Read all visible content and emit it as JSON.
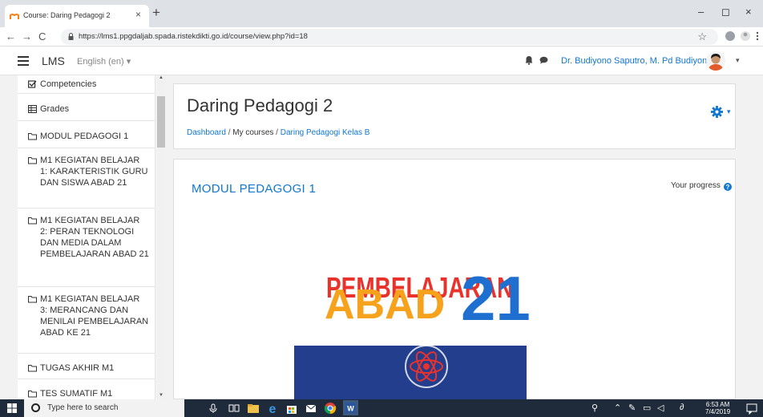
{
  "browser": {
    "tab_title": "Course: Daring Pedagogi 2",
    "tab_close": "×",
    "new_tab": "+",
    "url": "https://lms1.ppgdaljab.spada.ristekdikti.go.id/course/view.php?id=18",
    "nav_back": "←",
    "nav_forward": "→",
    "nav_reload": "C",
    "win_min": "–",
    "win_max": "◻",
    "win_close": "×",
    "star": "☆"
  },
  "navbar": {
    "brand": "LMS",
    "language": "English (en) ▾",
    "user_name": "Dr. Budiyono Saputro, M. Pd Budiyono",
    "user_caret": "▾"
  },
  "drawer": {
    "items": [
      {
        "icon": "checkbox-icon",
        "label": "Competencies"
      },
      {
        "icon": "table-icon",
        "label": "Grades"
      },
      {
        "icon": "folder-icon",
        "label": "MODUL PEDAGOGI 1"
      },
      {
        "icon": "folder-icon",
        "label": "M1 KEGIATAN BELAJAR 1: KARAKTERISTIK GURU DAN SISWA ABAD 21"
      },
      {
        "icon": "folder-icon",
        "label": "M1 KEGIATAN BELAJAR 2: PERAN TEKNOLOGI DAN MEDIA DALAM PEMBELAJARAN ABAD 21"
      },
      {
        "icon": "folder-icon",
        "label": "M1 KEGIATAN BELAJAR 3: MERANCANG DAN MENILAI PEMBELAJARAN ABAD KE 21"
      },
      {
        "icon": "folder-icon",
        "label": "TUGAS AKHIR M1"
      },
      {
        "icon": "folder-icon",
        "label": "TES SUMATIF M1"
      }
    ]
  },
  "course": {
    "title": "Daring Pedagogi 2",
    "breadcrumb": [
      "Dashboard",
      "My courses",
      "Daring Pedagogi Kelas B"
    ],
    "breadcrumb_sep": "/",
    "cog_caret": "▾"
  },
  "section": {
    "title": "MODUL PEDAGOGI 1",
    "progress_label": "Your progress",
    "banner_line1": "PEMBELAJARAN",
    "banner_line2": "ABAD",
    "banner_number": "21"
  },
  "taskbar": {
    "search_placeholder": "Type here to search",
    "time": "6:53 AM",
    "date": "7/4/2019"
  },
  "colors": {
    "link": "#1177d1",
    "banner_red": "#e8322b",
    "banner_orange": "#f7a21c",
    "banner_blue": "#1f6fd1",
    "taskbar": "#1f2b3a"
  }
}
